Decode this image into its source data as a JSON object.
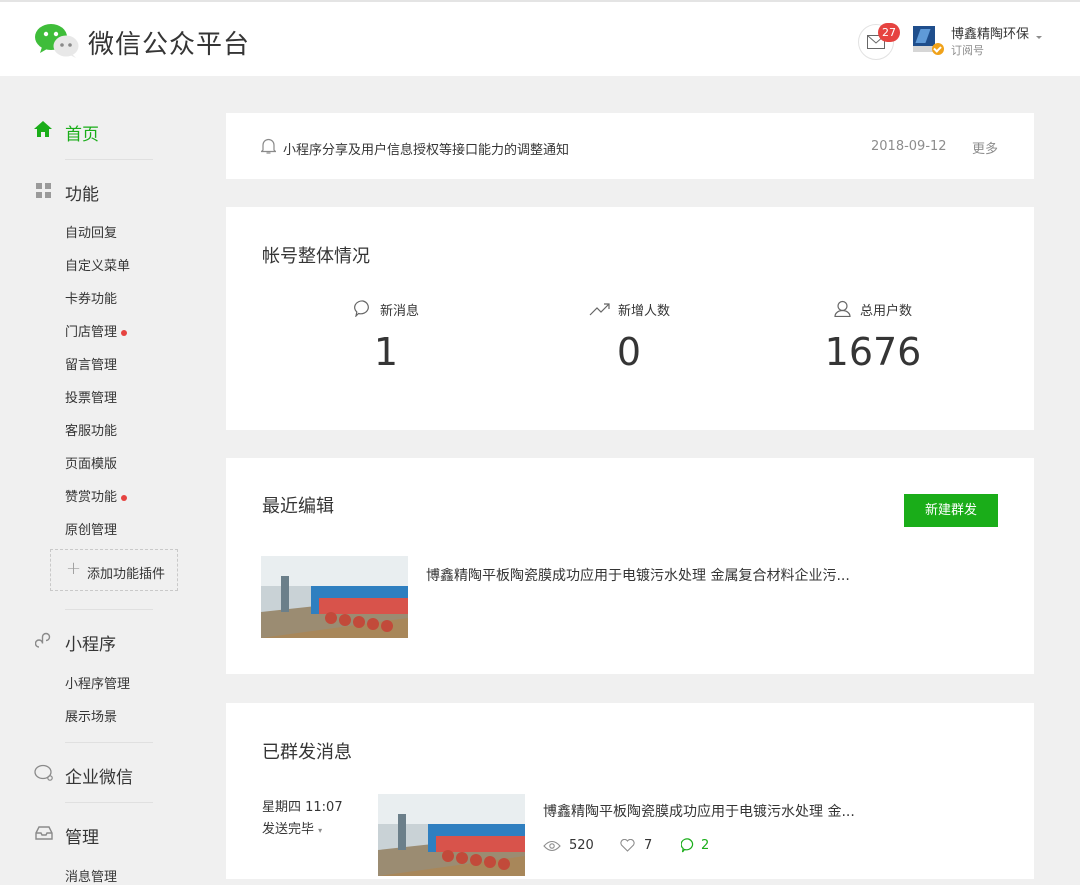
{
  "header": {
    "brand": "微信公众平台",
    "message_badge": "27",
    "account_name": "博鑫精陶环保",
    "account_type": "订阅号"
  },
  "sidebar": {
    "home": "首页",
    "features": {
      "label": "功能",
      "items": [
        "自动回复",
        "自定义菜单",
        "卡券功能",
        "门店管理",
        "留言管理",
        "投票管理",
        "客服功能",
        "页面模版",
        "赞赏功能",
        "原创管理"
      ],
      "add_plugin": "添加功能插件"
    },
    "miniprogram": {
      "label": "小程序",
      "items": [
        "小程序管理",
        "展示场景"
      ]
    },
    "work_wechat": "企业微信",
    "manage": {
      "label": "管理",
      "items": [
        "消息管理"
      ]
    }
  },
  "notice": {
    "text": "小程序分享及用户信息授权等接口能力的调整通知",
    "date": "2018-09-12",
    "more": "更多"
  },
  "overview": {
    "title": "帐号整体情况",
    "stats": [
      {
        "label": "新消息",
        "value": "1"
      },
      {
        "label": "新增人数",
        "value": "0"
      },
      {
        "label": "总用户数",
        "value": "1676"
      }
    ]
  },
  "recent_edit": {
    "title": "最近编辑",
    "new_button": "新建群发",
    "article_title": "博鑫精陶平板陶瓷膜成功应用于电镀污水处理 金属复合材料企业污..."
  },
  "sent": {
    "title": "已群发消息",
    "time": "星期四 11:07",
    "status": "发送完毕",
    "article_title": "博鑫精陶平板陶瓷膜成功应用于电镀污水处理 金...",
    "views": "520",
    "likes": "7",
    "comments": "2"
  },
  "colors": {
    "accent": "#1aad19",
    "badge": "#e64340"
  }
}
